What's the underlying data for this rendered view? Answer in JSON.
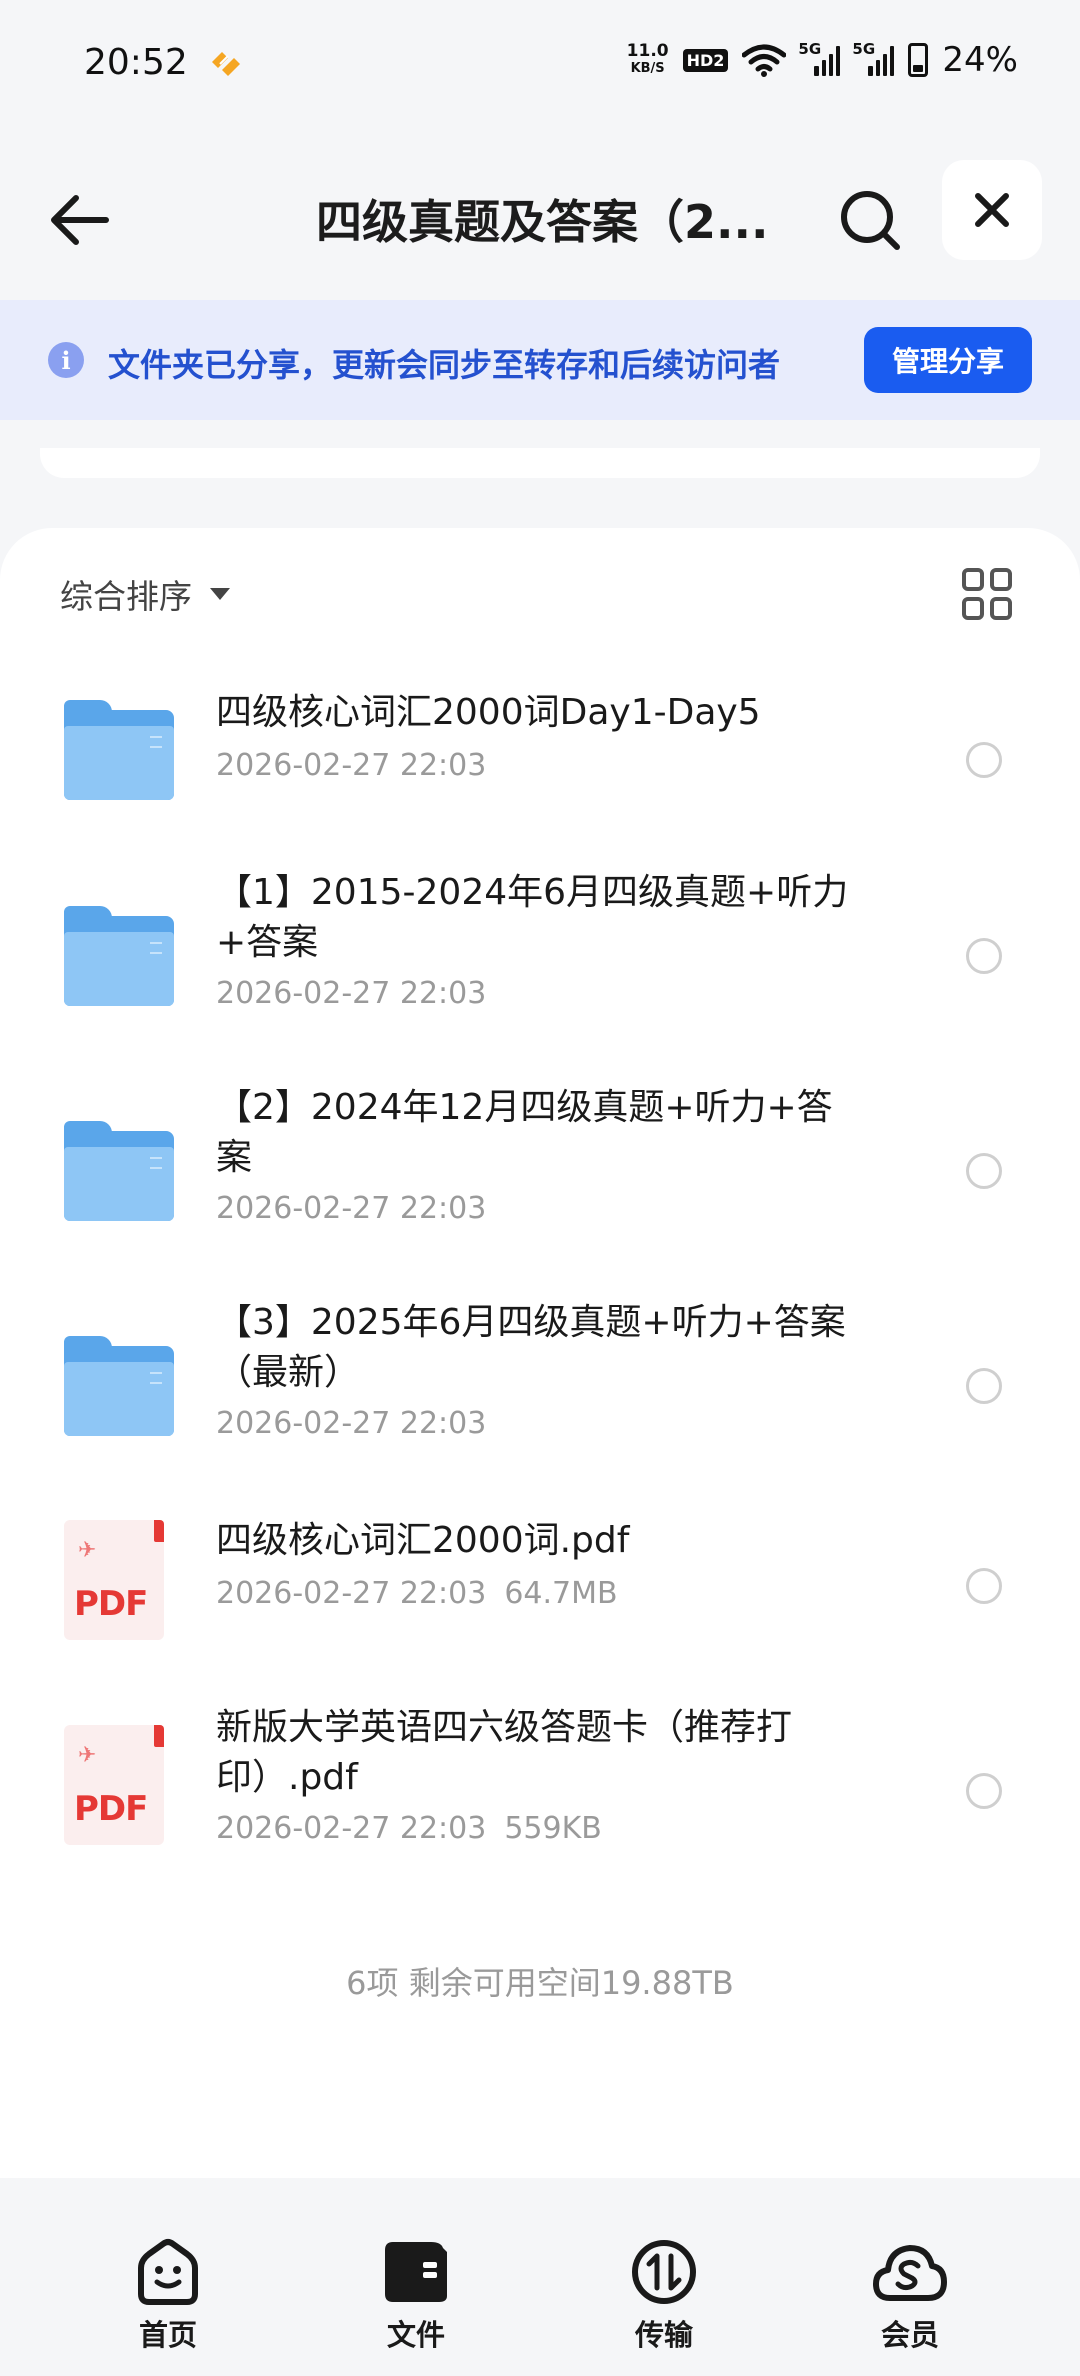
{
  "status_bar": {
    "time": "20:52",
    "net_speed_value": "11.0",
    "net_speed_unit": "KB/S",
    "hd_badge": "HD2",
    "signal_1": "5G",
    "signal_2": "5G",
    "battery_percent": "24%"
  },
  "header": {
    "title": "四级真题及答案（2...",
    "icons": [
      "back-arrow-icon",
      "search-icon",
      "close-icon"
    ]
  },
  "banner": {
    "message": "文件夹已分享，更新会同步至转存和后续访问者",
    "manage_label": "管理分享",
    "info_glyph": "i"
  },
  "sort": {
    "label": "综合排序"
  },
  "files": [
    {
      "type": "folder",
      "name": "四级核心词汇2000词Day1-Day5",
      "date": "2026-02-27 22:03",
      "size": ""
    },
    {
      "type": "folder",
      "name": "【1】2015-2024年6月四级真题+听力+答案",
      "date": "2026-02-27 22:03",
      "size": ""
    },
    {
      "type": "folder",
      "name": "【2】2024年12月四级真题+听力+答案",
      "date": "2026-02-27 22:03",
      "size": ""
    },
    {
      "type": "folder",
      "name": "【3】2025年6月四级真题+听力+答案（最新）",
      "date": "2026-02-27 22:03",
      "size": ""
    },
    {
      "type": "pdf",
      "name": "四级核心词汇2000词.pdf",
      "date": "2026-02-27 22:03",
      "size": "64.7MB"
    },
    {
      "type": "pdf",
      "name": "新版大学英语四六级答题卡（推荐打印）.pdf",
      "date": "2026-02-27 22:03",
      "size": "559KB"
    }
  ],
  "pdf_badge": "PDF",
  "summary": "6项 剩余可用空间19.88TB",
  "bottom_nav": {
    "home": "首页",
    "files": "文件",
    "transfer": "传输",
    "member": "会员",
    "selected": "files"
  },
  "colors": {
    "accent": "#1a5cf0",
    "banner_bg": "#e8ecfc",
    "banner_text": "#2451cf",
    "folder": "#8ec6f5",
    "pdf_red": "#e53935"
  }
}
